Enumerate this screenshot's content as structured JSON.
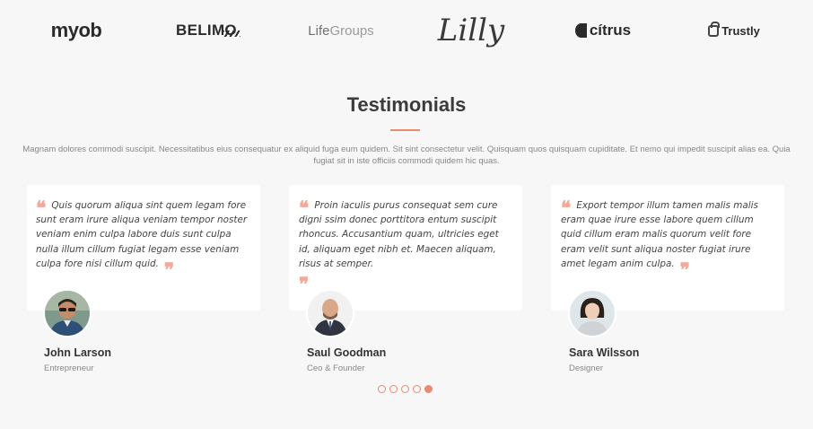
{
  "clients": {
    "logos": [
      {
        "name": "myob",
        "text": "myob"
      },
      {
        "name": "belimo",
        "text": "BELIMO"
      },
      {
        "name": "lifegroups",
        "text_a": "Life",
        "text_b": "Groups"
      },
      {
        "name": "lilly",
        "text": "Lilly"
      },
      {
        "name": "citrus",
        "text": "cítrus"
      },
      {
        "name": "trustly",
        "text": "Trustly"
      }
    ]
  },
  "testimonials": {
    "title": "Testimonials",
    "accent_color": "#e98b6e",
    "description": "Magnam dolores commodi suscipit. Necessitatibus eius consequatur ex aliquid fuga eum quidem. Sit sint consectetur velit. Quisquam quos quisquam cupiditate. Et nemo qui impedit suscipit alias ea. Quia fugiat sit in iste officiis commodi quidem hic quas.",
    "items": [
      {
        "quote": "Quis quorum aliqua sint quem legam fore sunt eram irure aliqua veniam tempor noster veniam enim culpa labore duis sunt culpa nulla illum cillum fugiat legam esse veniam culpa fore nisi cillum quid.",
        "name": "John Larson",
        "role": "Entrepreneur"
      },
      {
        "quote": "Proin iaculis purus consequat sem cure digni ssim donec porttitora entum suscipit rhoncus. Accusantium quam, ultricies eget id, aliquam eget nibh et. Maecen aliquam, risus at semper.",
        "name": "Saul Goodman",
        "role": "Ceo & Founder"
      },
      {
        "quote": "Export tempor illum tamen malis malis eram quae irure esse labore quem cillum quid cillum eram malis quorum velit fore eram velit sunt aliqua noster fugiat irure amet legam anim culpa.",
        "name": "Sara Wilsson",
        "role": "Designer"
      }
    ],
    "pagination": {
      "total": 5,
      "active_index": 4
    }
  }
}
